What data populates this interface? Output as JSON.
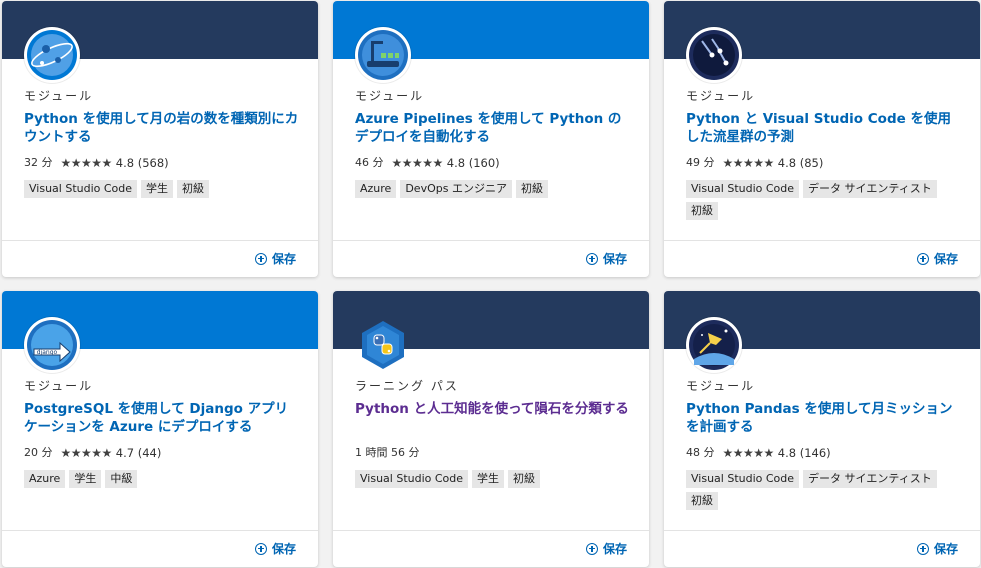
{
  "cards": [
    {
      "banner": "dark",
      "icon": "moon-globe-icon",
      "type": "モジュール",
      "title": "Python を使用して月の岩の数を種類別にカウントする",
      "duration": "32 分",
      "stars": "★★★★★",
      "rating": "4.8 (568)",
      "tags": [
        "Visual Studio Code",
        "学生",
        "初級"
      ],
      "save": "保存"
    },
    {
      "banner": "blue",
      "icon": "pipeline-robot-icon",
      "type": "モジュール",
      "title": "Azure Pipelines を使用して Python のデプロイを自動化する",
      "duration": "46 分",
      "stars": "★★★★★",
      "rating": "4.8 (160)",
      "tags": [
        "Azure",
        "DevOps エンジニア",
        "初級"
      ],
      "save": "保存"
    },
    {
      "banner": "dark",
      "icon": "meteor-shower-icon",
      "type": "モジュール",
      "title": "Python と Visual Studio Code を使用した流星群の予測",
      "duration": "49 分",
      "stars": "★★★★★",
      "rating": "4.8 (85)",
      "tags": [
        "Visual Studio Code",
        "データ サイエンティスト",
        "初級"
      ],
      "save": "保存"
    },
    {
      "banner": "blue",
      "icon": "django-cloud-icon",
      "icon_text": "django",
      "type": "モジュール",
      "title": "PostgreSQL を使用して Django アプリケーションを Azure にデプロイする",
      "duration": "20 分",
      "stars": "★★★★★",
      "rating": "4.7 (44)",
      "tags": [
        "Azure",
        "学生",
        "中級"
      ],
      "save": "保存"
    },
    {
      "banner": "dark",
      "icon": "python-hexagon-icon",
      "type": "ラーニング パス",
      "title": "Python と人工知能を使って隕石を分類する",
      "duration": "1 時間 56 分",
      "stars": "",
      "rating": "",
      "tags": [
        "Visual Studio Code",
        "学生",
        "初級"
      ],
      "save": "保存"
    },
    {
      "banner": "dark",
      "icon": "moon-rocket-icon",
      "type": "モジュール",
      "title": "Python Pandas を使用して月ミッションを計画する",
      "duration": "48 分",
      "stars": "★★★★★",
      "rating": "4.8 (146)",
      "tags": [
        "Visual Studio Code",
        "データ サイエンティスト",
        "初級"
      ],
      "save": "保存"
    }
  ]
}
